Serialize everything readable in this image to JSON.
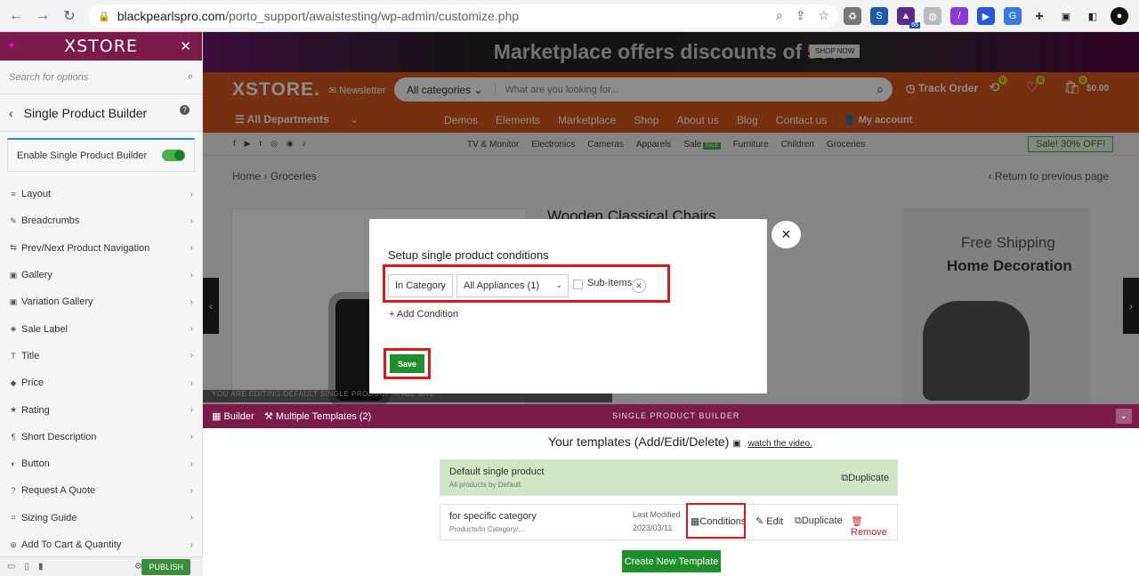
{
  "browser": {
    "url_host": "blackpearlspro.com",
    "url_path": "/porto_support/awaistesting/wp-admin/customize.php",
    "ext_badge": "66"
  },
  "sidebar": {
    "logo": "XSTORE",
    "search_placeholder": "Search for options",
    "title": "Single Product Builder",
    "toggle_label": "Enable Single Product Builder",
    "items": [
      {
        "label": "Layout",
        "icon": "list-icon"
      },
      {
        "label": "Breadcrumbs",
        "icon": "pencil-icon"
      },
      {
        "label": "Prev/Next Product Navigation",
        "icon": "arrows-icon"
      },
      {
        "label": "Gallery",
        "icon": "image-icon"
      },
      {
        "label": "Variation Gallery",
        "icon": "image-icon"
      },
      {
        "label": "Sale Label",
        "icon": "tag-icon"
      },
      {
        "label": "Title",
        "icon": "text-icon"
      },
      {
        "label": "Price",
        "icon": "price-tag-icon"
      },
      {
        "label": "Rating",
        "icon": "star-icon"
      },
      {
        "label": "Short Description",
        "icon": "paragraph-icon"
      },
      {
        "label": "Button",
        "icon": "button-icon"
      },
      {
        "label": "Request A Quote",
        "icon": "question-icon"
      },
      {
        "label": "Sizing Guide",
        "icon": "ruler-icon"
      },
      {
        "label": "Add To Cart & Quantity",
        "icon": "cart-icon"
      }
    ],
    "publish_label": "PUBLISH"
  },
  "preview": {
    "promo_text": "Marketplace offers discounts of",
    "promo_pct": "50%",
    "promo_btn": "SHOP NOW",
    "brand": "XSTORE.",
    "newsletter": "Newsletter",
    "search_category": "All categories",
    "search_placeholder": "What are you looking for...",
    "track_order": "Track Order",
    "cart_total": "$0.00",
    "badge_count": "0",
    "departments": "All Departments",
    "menu": [
      "Demos",
      "Elements",
      "Marketplace",
      "Shop",
      "About us",
      "Blog",
      "Contact us"
    ],
    "my_account": "My account",
    "categories": [
      "TV & Monitor",
      "Electronics",
      "Cameras",
      "Apparels",
      "Sale",
      "Furniture",
      "Children",
      "Groceries"
    ],
    "sale_tag": "SALE",
    "sale_pill": "Sale! 30% OFF!",
    "breadcrumb": [
      "Home",
      "Groceries"
    ],
    "return_link": "Return to previous page",
    "product_title": "Wooden Classical Chairs",
    "free_shipping": "Free Shipping",
    "home_decoration": "Home Decoration",
    "editing_notice": "YOU ARE EDITING DEFAULT SINGLE PRODUCT -> ALL SITE"
  },
  "modal": {
    "title": "Setup single product conditions",
    "condition_type": "In Category",
    "condition_value": "All Appliances (1)",
    "subitems_label": "Sub-Items",
    "add_condition": "Add Condition",
    "save": "Save"
  },
  "builder": {
    "builder_label": "Builder",
    "multiple_templates": "Multiple Templates (2)",
    "center_title": "SINGLE PRODUCT BUILDER",
    "your_templates": "Your templates (Add/Edit/Delete)",
    "watch_video": "watch the video.",
    "templates": [
      {
        "name": "Default single product",
        "sub": "All products by Default",
        "duplicate": "Duplicate"
      },
      {
        "name": "for specific category",
        "sub": "Products/In Category/...",
        "last_modified_label": "Last Modified",
        "last_modified": "2023/03/11",
        "conditions": "Conditions",
        "edit": "Edit",
        "duplicate": "Duplicate",
        "remove": "Remove"
      }
    ],
    "create_new": "Create New Template"
  },
  "colors": {
    "brand_purple": "#7b1b4a",
    "header_orange": "#d8581c",
    "save_green": "#1e8f2a",
    "highlight_red": "#e0141b"
  }
}
